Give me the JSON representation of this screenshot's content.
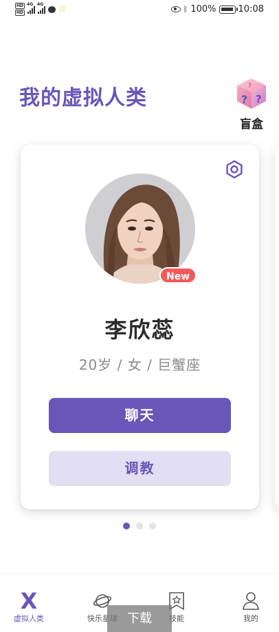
{
  "status_bar": {
    "battery": "100%",
    "time": "10:08",
    "network_labels": [
      "4G",
      "4G"
    ],
    "hd_labels": [
      "HD",
      "HD"
    ]
  },
  "header": {
    "title": "我的虚拟人类",
    "blind_box_label": "盲盒",
    "blind_box_icon": "mystery-cube-icon"
  },
  "character": {
    "name": "李欣蕊",
    "info": "20岁 / 女 / 巨蟹座",
    "badge": "New",
    "settings_icon": "gear-icon",
    "chat_label": "聊天",
    "train_label": "调教"
  },
  "pager": {
    "count": 3,
    "active_index": 0
  },
  "tab_bar": {
    "items": [
      {
        "label": "虚拟人类",
        "icon": "x-logo-icon",
        "active": true
      },
      {
        "label": "快乐星球",
        "icon": "planet-icon",
        "active": false
      },
      {
        "label": "技能",
        "icon": "bookmark-star-icon",
        "active": false
      },
      {
        "label": "我的",
        "icon": "person-icon",
        "active": false
      }
    ]
  },
  "overlay": {
    "download_label": "下载"
  },
  "colors": {
    "accent": "#6a55b9",
    "accent_light": "#e3dff2",
    "badge": "#f05a5a"
  }
}
